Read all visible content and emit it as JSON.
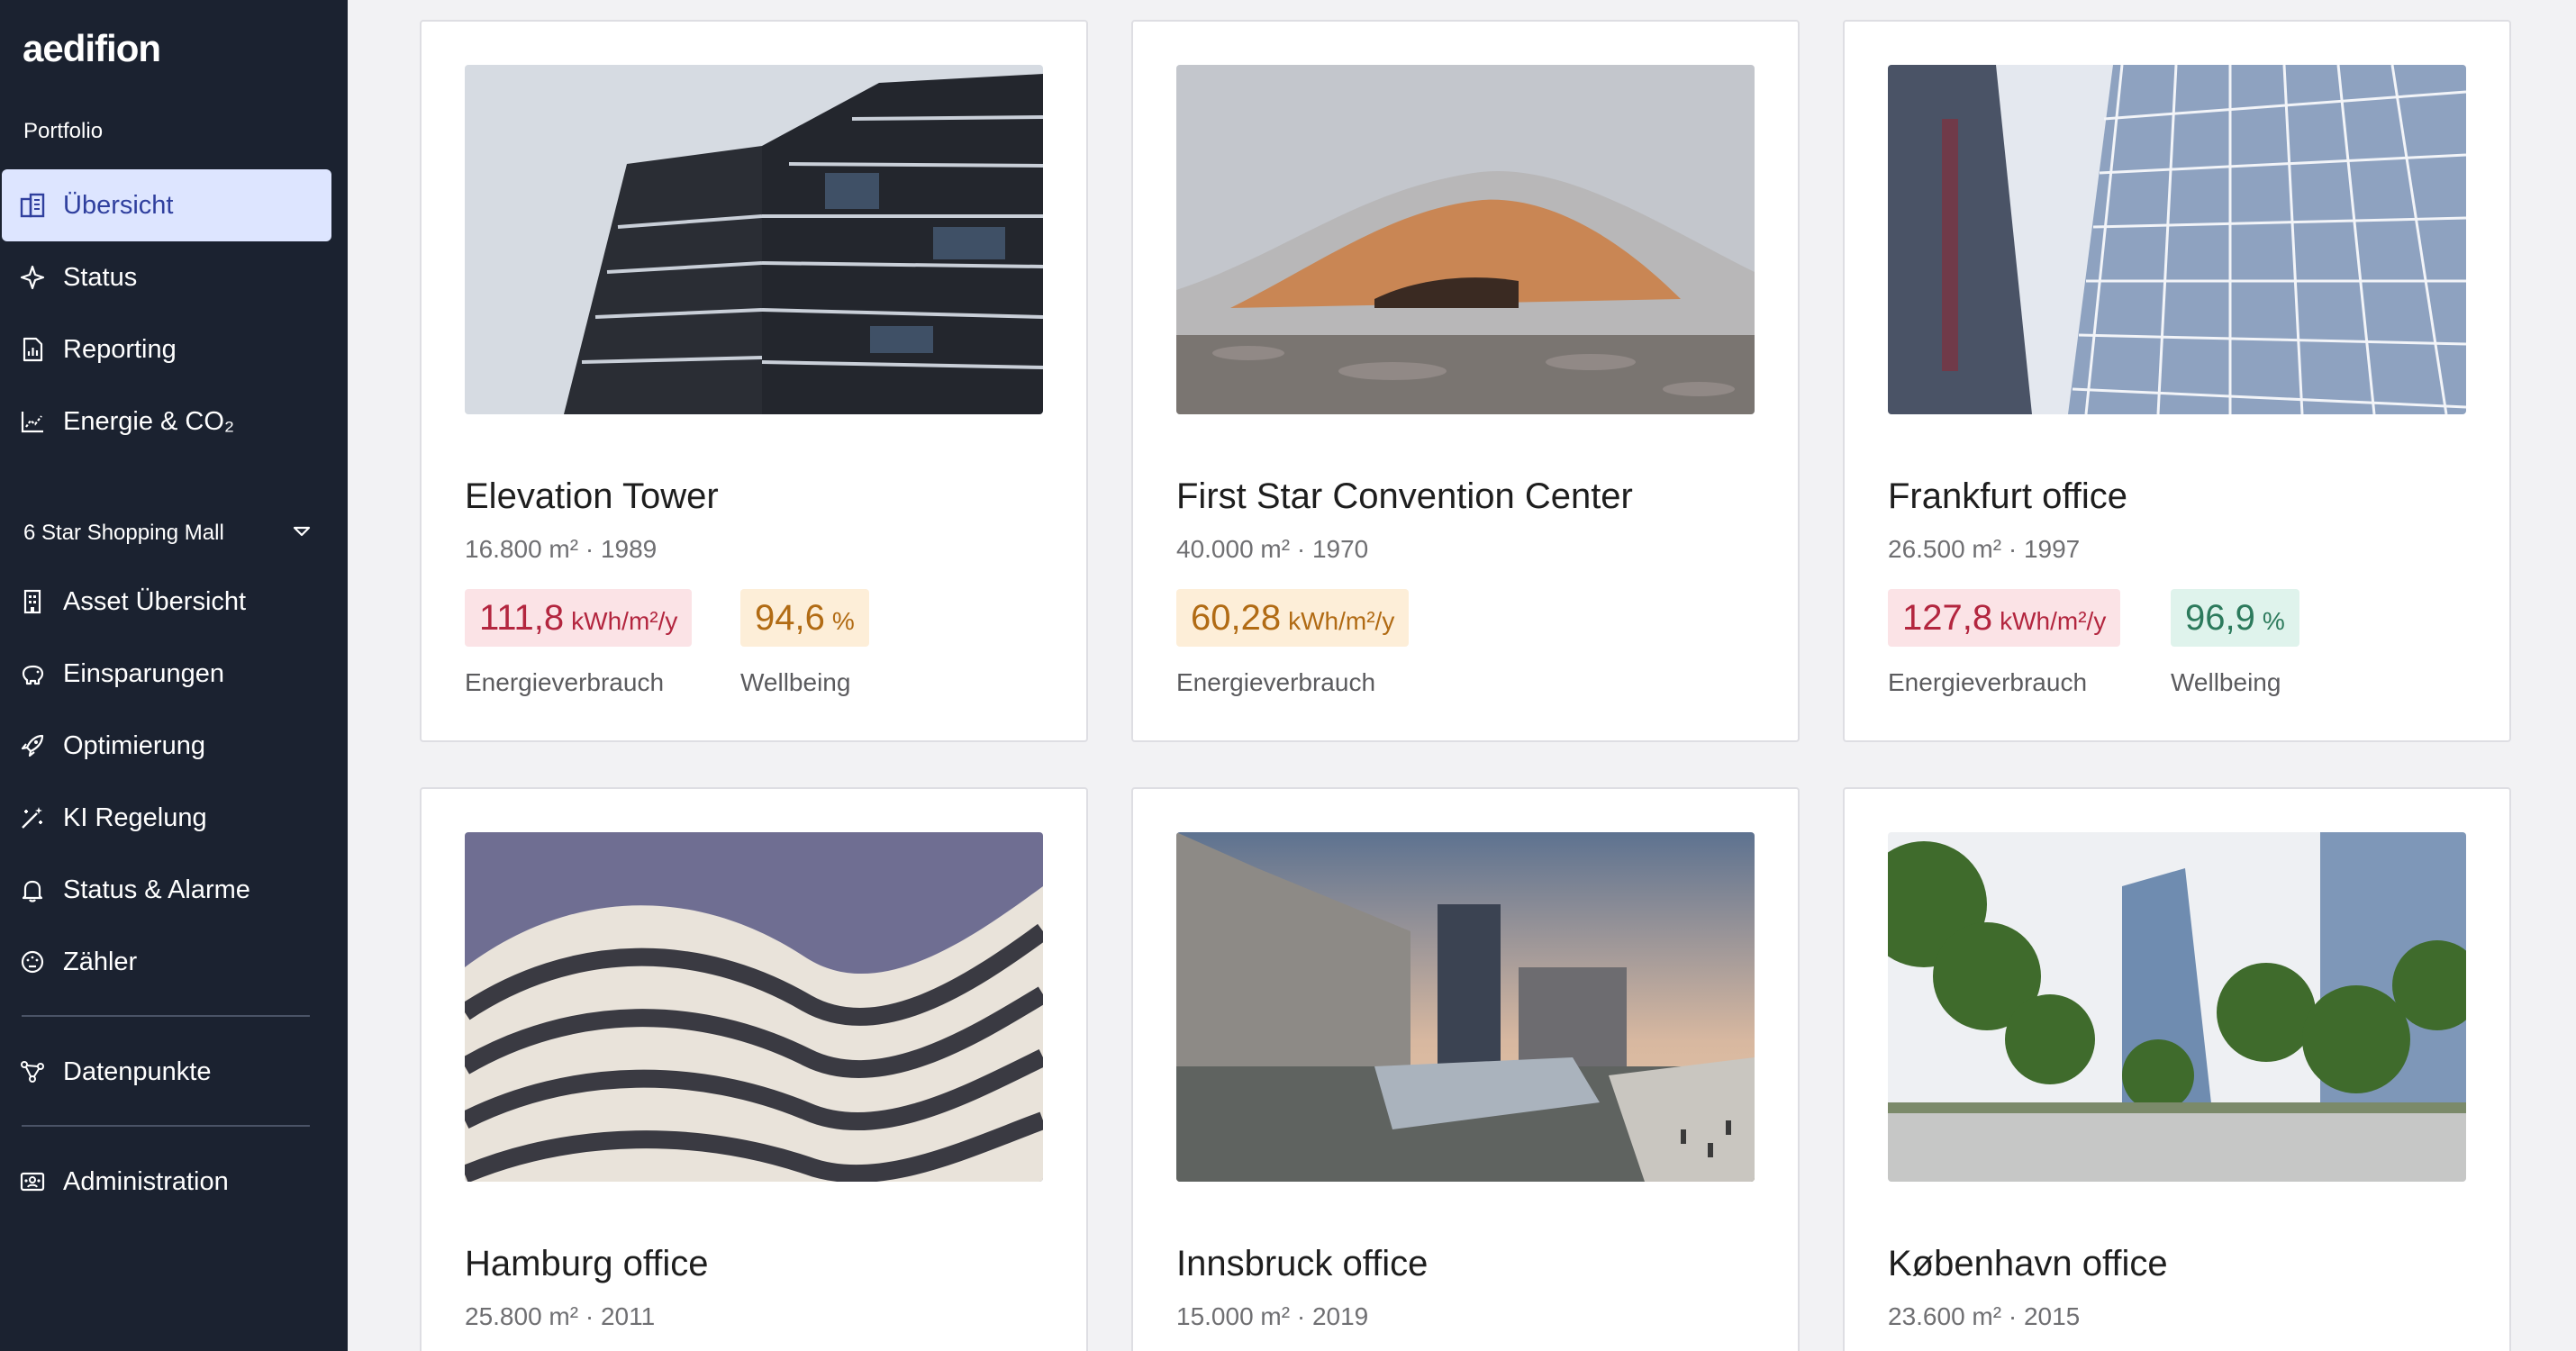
{
  "app": {
    "logo": "aedifion"
  },
  "sidebar": {
    "portfolio_label": "Portfolio",
    "portfolio_items": [
      {
        "label": "Übersicht",
        "icon": "buildings-icon",
        "active": true
      },
      {
        "label": "Status",
        "icon": "sparkle-icon"
      },
      {
        "label": "Reporting",
        "icon": "report-icon"
      },
      {
        "label": "Energie & CO₂",
        "icon": "line-chart-icon"
      }
    ],
    "asset_select": "6 Star Shopping Mall",
    "asset_items": [
      {
        "label": "Asset Übersicht",
        "icon": "building-icon"
      },
      {
        "label": "Einsparungen",
        "icon": "piggy-bank-icon"
      },
      {
        "label": "Optimierung",
        "icon": "rocket-icon"
      },
      {
        "label": "KI Regelung",
        "icon": "magic-wand-icon"
      },
      {
        "label": "Status & Alarme",
        "icon": "bell-icon"
      },
      {
        "label": "Zähler",
        "icon": "gauge-icon"
      }
    ],
    "data_items": [
      {
        "label": "Datenpunkte",
        "icon": "nodes-icon"
      }
    ],
    "admin_items": [
      {
        "label": "Administration",
        "icon": "admin-icon"
      }
    ]
  },
  "buildings": [
    {
      "name": "Elevation Tower",
      "meta": "16.800 m² · 1989",
      "metrics": [
        {
          "value": "111,8",
          "unit": "kWh/m²/y",
          "label": "Energieverbrauch",
          "tone": "red"
        },
        {
          "value": "94,6",
          "unit": "%",
          "label": "Wellbeing",
          "tone": "orange"
        }
      ]
    },
    {
      "name": "First Star Convention Center",
      "meta": "40.000 m² · 1970",
      "metrics": [
        {
          "value": "60,28",
          "unit": "kWh/m²/y",
          "label": "Energieverbrauch",
          "tone": "orange"
        }
      ]
    },
    {
      "name": "Frankfurt office",
      "meta": "26.500 m² · 1997",
      "metrics": [
        {
          "value": "127,8",
          "unit": "kWh/m²/y",
          "label": "Energieverbrauch",
          "tone": "red"
        },
        {
          "value": "96,9",
          "unit": "%",
          "label": "Wellbeing",
          "tone": "green"
        }
      ]
    },
    {
      "name": "Hamburg office",
      "meta": "25.800 m² · 2011",
      "metrics": []
    },
    {
      "name": "Innsbruck office",
      "meta": "15.000 m² · 2019",
      "metrics": []
    },
    {
      "name": "København office",
      "meta": "23.600 m² · 2015",
      "metrics": []
    }
  ],
  "colors": {
    "sidebar_bg": "#1b2230",
    "active_bg": "#dde5ff",
    "active_text": "#2f3f9e",
    "red": "#b3263f",
    "orange": "#b16b14",
    "green": "#2c7a5c"
  }
}
